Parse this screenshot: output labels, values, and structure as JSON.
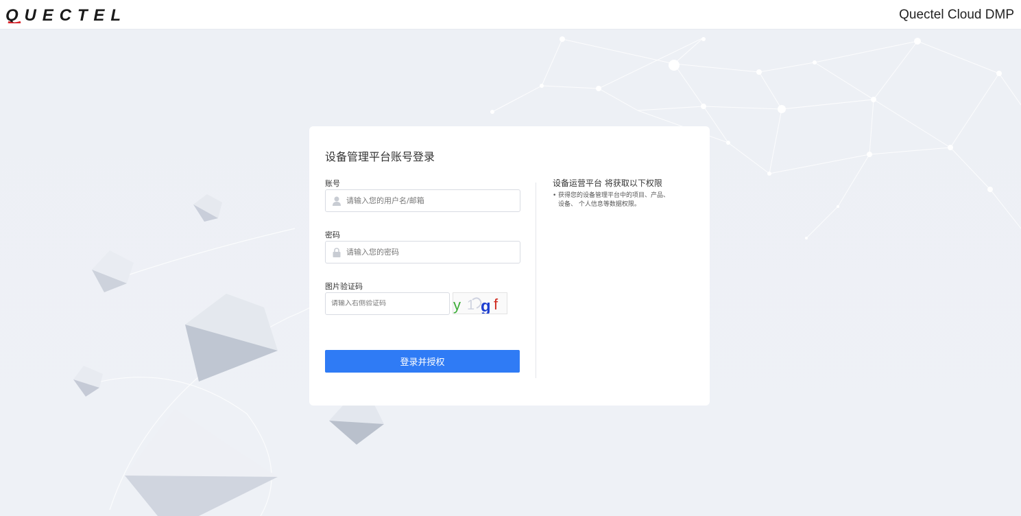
{
  "header": {
    "logo_text": "QUECTEL",
    "app_title": "Quectel Cloud DMP"
  },
  "login": {
    "title": "设备管理平台账号登录",
    "account_label": "账号",
    "account_placeholder": "请输入您的用户名/邮箱",
    "password_label": "密码",
    "password_placeholder": "请输入您的密码",
    "captcha_label": "图片验证码",
    "captcha_placeholder": "请输入右侧验证码",
    "captcha_chars": [
      "y",
      "1",
      "g",
      "f"
    ],
    "submit_label": "登录并授权"
  },
  "permissions": {
    "title": "设备运营平台 将获取以下权限",
    "line1": "获得您的设备管理平台中的项目、产品、",
    "line2": "设备、 个人信息等数据权限。"
  },
  "colors": {
    "brand_red": "#d8232a",
    "primary_button": "#2f7bf5",
    "background": "#eef1f6"
  },
  "icons": {
    "account": "user-icon",
    "password": "lock-icon"
  }
}
